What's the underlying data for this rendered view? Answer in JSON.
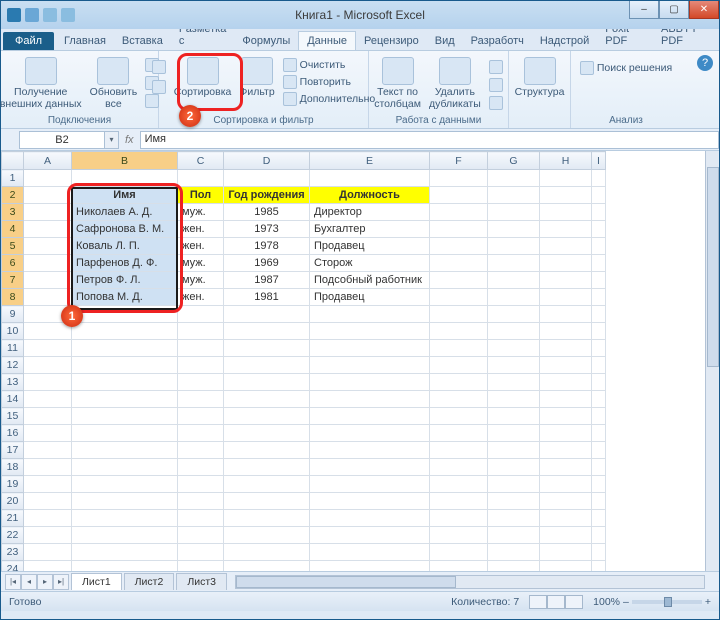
{
  "window": {
    "title": "Книга1 - Microsoft Excel"
  },
  "win_buttons": {
    "min": "–",
    "max": "▢",
    "close": "✕"
  },
  "tabs": {
    "file": "Файл",
    "items": [
      "Главная",
      "Вставка",
      "Разметка с",
      "Формулы",
      "Данные",
      "Рецензиро",
      "Вид",
      "Разработч",
      "Надстрой",
      "Foxit PDF",
      "ABBYY PDF"
    ],
    "active_index": 4
  },
  "ribbon": {
    "group_connections": {
      "get_external_data": "Получение\nвнешних данных",
      "refresh_all": "Обновить\nвсе",
      "connections": "Подключения",
      "properties": "Свойства",
      "edit_links": "Изменить связи",
      "label": "Подключения"
    },
    "group_sort_filter": {
      "sort_az": "А↓Я",
      "sort_za": "Я↓А",
      "sort": "Сортировка",
      "filter": "Фильтр",
      "clear": "Очистить",
      "reapply": "Повторить",
      "advanced": "Дополнительно",
      "label": "Сортировка и фильтр"
    },
    "group_data_tools": {
      "text_to_columns": "Текст по\nстолбцам",
      "remove_duplicates": "Удалить\nдубликаты",
      "label": "Работа с данными"
    },
    "group_outline": {
      "outline": "Структура"
    },
    "group_analysis": {
      "solver": "Поиск решения",
      "label": "Анализ"
    }
  },
  "namebox": {
    "cell_ref": "B2",
    "formula_value": "Имя"
  },
  "columns": [
    "A",
    "B",
    "C",
    "D",
    "E",
    "F",
    "G",
    "H",
    "I"
  ],
  "row_numbers": [
    1,
    2,
    3,
    4,
    5,
    6,
    7,
    8,
    9,
    10,
    11,
    12,
    13,
    14,
    15,
    16,
    17,
    18,
    19,
    20,
    21,
    22,
    23,
    24
  ],
  "table": {
    "headers": {
      "B": "Имя",
      "C": "Пол",
      "D": "Год рождения",
      "E": "Должность"
    },
    "rows": [
      {
        "B": "Николаев А. Д.",
        "C": "муж.",
        "D": "1985",
        "E": "Директор"
      },
      {
        "B": "Сафронова В. М.",
        "C": "жен.",
        "D": "1973",
        "E": "Бухгалтер"
      },
      {
        "B": "Коваль Л. П.",
        "C": "жен.",
        "D": "1978",
        "E": "Продавец"
      },
      {
        "B": "Парфенов Д. Ф.",
        "C": "муж.",
        "D": "1969",
        "E": "Сторож"
      },
      {
        "B": "Петров Ф. Л.",
        "C": "муж.",
        "D": "1987",
        "E": "Подсобный работник"
      },
      {
        "B": "Попова М. Д.",
        "C": "жен.",
        "D": "1981",
        "E": "Продавец"
      }
    ]
  },
  "callouts": {
    "one": "1",
    "two": "2"
  },
  "sheet_tabs": {
    "sheets": [
      "Лист1",
      "Лист2",
      "Лист3"
    ],
    "active": 0
  },
  "statusbar": {
    "ready": "Готово",
    "count_label": "Количество: 7",
    "zoom": "100%",
    "minus": "–",
    "plus": "+"
  }
}
